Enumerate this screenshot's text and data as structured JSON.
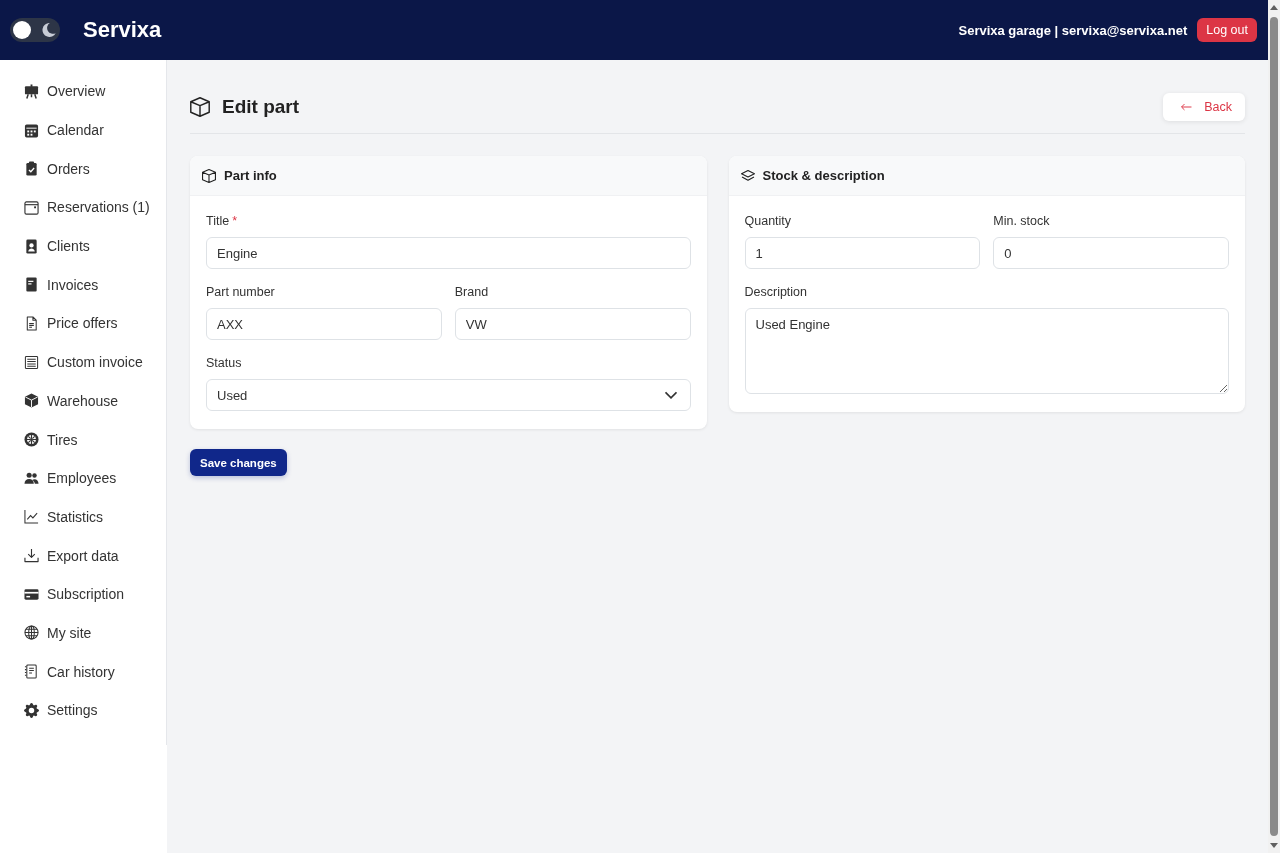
{
  "header": {
    "theme_toggle": {
      "on": false
    },
    "brand": "Servixa",
    "account": "Servixa garage | servixa@servixa.net",
    "logout_button": "Log out"
  },
  "sidebar": {
    "items": [
      {
        "label": "Overview",
        "selected": false
      },
      {
        "label": "Calendar",
        "selected": false
      },
      {
        "label": "Orders",
        "selected": false
      },
      {
        "label": "Reservations (1)",
        "selected": false
      },
      {
        "label": "Clients",
        "selected": false
      },
      {
        "label": "Invoices",
        "selected": false
      },
      {
        "label": "Price offers",
        "selected": false
      },
      {
        "label": "Custom invoice",
        "selected": false
      },
      {
        "label": "Warehouse",
        "selected": false
      },
      {
        "label": "Tires",
        "selected": false
      },
      {
        "label": "Employees",
        "selected": false
      },
      {
        "label": "Statistics",
        "selected": false
      },
      {
        "label": "Export data",
        "selected": false
      },
      {
        "label": "Subscription",
        "selected": false
      },
      {
        "label": "My site",
        "selected": false
      },
      {
        "label": "Car history",
        "selected": false
      },
      {
        "label": "Settings",
        "selected": false
      }
    ]
  },
  "page": {
    "title": "Edit part",
    "back_button": "Back"
  },
  "cards": [
    {
      "title": "Part info",
      "rows": [
        [
          {
            "label": "Title",
            "required_mark": "*",
            "kind": "text",
            "value": "Engine"
          }
        ],
        [
          {
            "label": "Part number",
            "kind": "text",
            "value": "AXX"
          },
          {
            "label": "Brand",
            "kind": "text",
            "value": "VW"
          }
        ],
        [
          {
            "label": "Status",
            "kind": "select",
            "value": "Used"
          }
        ]
      ]
    },
    {
      "title": "Stock & description",
      "rows": [
        [
          {
            "label": "Quantity",
            "kind": "text",
            "value": "1"
          },
          {
            "label": "Min. stock",
            "kind": "text",
            "value": "0"
          }
        ],
        [
          {
            "label": "Description",
            "kind": "textarea",
            "value": "Used Engine"
          }
        ]
      ]
    }
  ],
  "save_button": "Save changes"
}
